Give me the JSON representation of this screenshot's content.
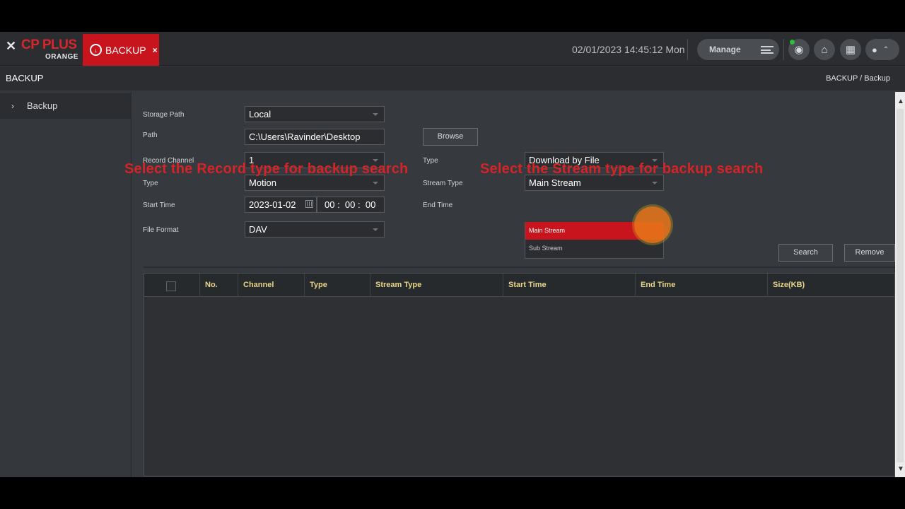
{
  "header": {
    "logo_cross": "✕",
    "logo_brand": "CP PLUS",
    "logo_sub": "ORANGE",
    "tab_label": "BACKUP",
    "tab_close": "×",
    "datetime": "02/01/2023 14:45:12 Mon",
    "manage_label": "Manage"
  },
  "page": {
    "title": "BACKUP",
    "breadcrumb": "BACKUP / Backup"
  },
  "sidebar": {
    "items": [
      {
        "label": "Backup"
      }
    ]
  },
  "form": {
    "storage_path_label": "Storage Path",
    "storage_path_value": "Local",
    "path_label": "Path",
    "path_value": "C:\\Users\\Ravinder\\Desktop",
    "browse_label": "Browse",
    "record_channel_label": "Record Channel",
    "record_channel_value": "1",
    "type_label": "Type",
    "type_value": "Motion",
    "start_time_label": "Start Time",
    "start_date": "2023-01-02",
    "start_hh": "00",
    "start_mm": "00",
    "start_ss": "00",
    "file_format_label": "File Format",
    "file_format_value": "DAV",
    "download_type_label": "Type",
    "download_type_value": "Download by File",
    "stream_type_label": "Stream Type",
    "stream_type_value": "Main Stream",
    "end_time_label": "End Time",
    "stream_options": [
      "Main Stream",
      "Sub Stream"
    ],
    "search_label": "Search",
    "remove_label": "Remove"
  },
  "overlays": {
    "left": "Select the Record type for backup search",
    "right": "Select the Stream type for backup search"
  },
  "table": {
    "columns": [
      "No.",
      "Channel",
      "Type",
      "Stream Type",
      "Start Time",
      "End Time",
      "Size(KB)"
    ]
  },
  "colors": {
    "accent": "#c8141d",
    "header_text": "#e8d589",
    "overlay_text": "#d42427"
  }
}
